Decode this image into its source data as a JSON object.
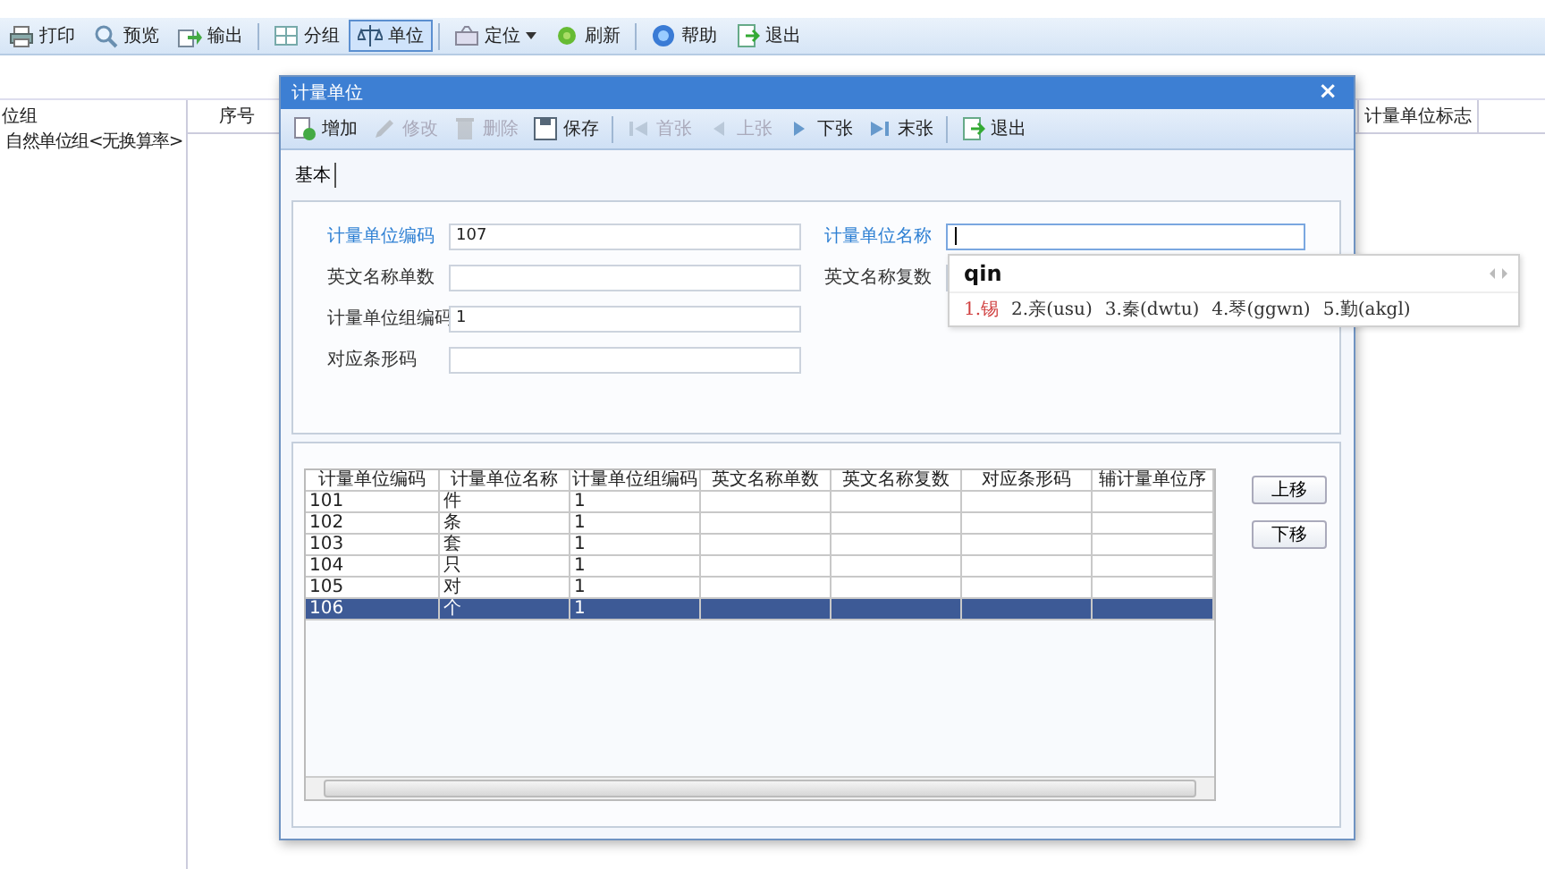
{
  "toolbar": [
    [
      {
        "label": "打印",
        "selected": false,
        "dropdown": false
      },
      {
        "label": "预览",
        "selected": false,
        "dropdown": false
      },
      {
        "label": "输出",
        "selected": false,
        "dropdown": false
      }
    ],
    [
      {
        "label": "分组",
        "selected": false,
        "dropdown": false
      },
      {
        "label": "单位",
        "selected": true,
        "dropdown": false
      }
    ],
    [
      {
        "label": "定位",
        "selected": false,
        "dropdown": true
      },
      {
        "label": "刷新",
        "selected": false,
        "dropdown": false
      }
    ],
    [
      {
        "label": "帮助",
        "selected": false,
        "dropdown": false
      },
      {
        "label": "退出",
        "selected": false,
        "dropdown": false
      }
    ]
  ],
  "tree": [
    {
      "label": "位组",
      "children": [
        {
          "label": "自然单位组<无换算率>"
        }
      ]
    }
  ],
  "main_table": {
    "columns": [
      "序号",
      "计量单位标志"
    ]
  },
  "dialog": {
    "title": "计量单位",
    "close": "×",
    "toolbar": [
      [
        {
          "label": "增加",
          "disabled": false
        },
        {
          "label": "修改",
          "disabled": true
        },
        {
          "label": "删除",
          "disabled": true
        },
        {
          "label": "保存",
          "disabled": false
        }
      ],
      [
        {
          "label": "首张",
          "disabled": true
        },
        {
          "label": "上张",
          "disabled": true
        },
        {
          "label": "下张",
          "disabled": false
        },
        {
          "label": "末张",
          "disabled": false
        }
      ],
      [
        {
          "label": "退出",
          "disabled": false
        }
      ]
    ],
    "tabs": [
      {
        "label": "基本",
        "selected": true
      }
    ],
    "left_fields": [
      {
        "label": "计量单位编码",
        "value": "107",
        "required": true,
        "focused": false
      },
      {
        "label": "英文名称单数",
        "required": false,
        "focused": false
      },
      {
        "label": "计量单位组编码",
        "value": "1",
        "required": false,
        "focused": false
      },
      {
        "label": "对应条形码",
        "required": false,
        "focused": false
      }
    ],
    "right_fields": [
      {
        "label": "计量单位名称",
        "required": true,
        "focused": true
      },
      {
        "label": "英文名称复数",
        "required": false,
        "focused": false
      }
    ],
    "grid": {
      "columns": [
        "计量单位编码",
        "计量单位名称",
        "计量单位组编码",
        "英文名称单数",
        "英文名称复数",
        "对应条形码",
        "辅计量单位序"
      ],
      "rows": [
        {
          "cells": [
            "101",
            "件",
            "1"
          ],
          "selected": false
        },
        {
          "cells": [
            "102",
            "条",
            "1"
          ],
          "selected": false
        },
        {
          "cells": [
            "103",
            "套",
            "1"
          ],
          "selected": false
        },
        {
          "cells": [
            "104",
            "只",
            "1"
          ],
          "selected": false
        },
        {
          "cells": [
            "105",
            "对",
            "1"
          ],
          "selected": false
        },
        {
          "cells": [
            "106",
            "个",
            "1"
          ],
          "selected": true
        }
      ]
    },
    "buttons": [
      "上移",
      "下移"
    ]
  },
  "ime": {
    "composition": "qin",
    "candidates": [
      {
        "label": "1.锡",
        "selected": true
      },
      {
        "label": "2.亲(usu)",
        "selected": false
      },
      {
        "label": "3.秦(dwtu)",
        "selected": false
      },
      {
        "label": "4.琴(ggwn)",
        "selected": false
      },
      {
        "label": "5.勤(akgl)",
        "selected": false
      }
    ]
  }
}
